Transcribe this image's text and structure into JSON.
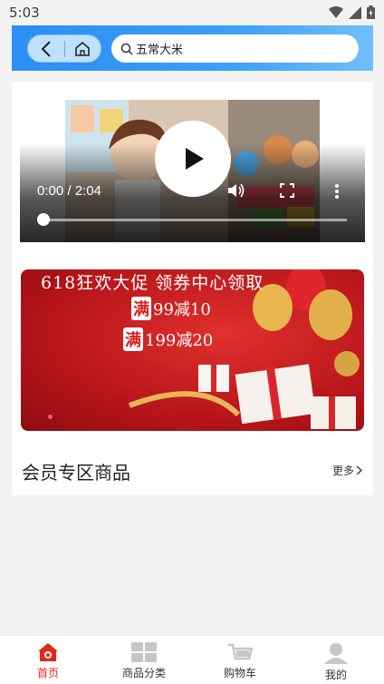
{
  "status_bar": {
    "time": "5:03"
  },
  "header": {
    "search_text": "五常大米"
  },
  "video": {
    "time": "0:00 / 2:04",
    "progress": 0
  },
  "banner": {
    "headline": "618狂欢大促  领券中心领取",
    "coupon1_mark": "满",
    "coupon1_text": "99减10",
    "coupon2_mark": "满",
    "coupon2_text": "199减20"
  },
  "section": {
    "title": "会员专区商品",
    "more": "更多"
  },
  "tabbar": {
    "items": [
      {
        "label": "首页",
        "icon": "home-icon",
        "active": true
      },
      {
        "label": "商品分类",
        "icon": "category-icon",
        "active": false
      },
      {
        "label": "购物车",
        "icon": "cart-icon",
        "active": false
      },
      {
        "label": "我的",
        "icon": "user-icon",
        "active": false
      }
    ]
  },
  "colors": {
    "accent": "#e0281f",
    "header_blue": "#2b8ff3",
    "banner_red": "#c41a1e"
  }
}
